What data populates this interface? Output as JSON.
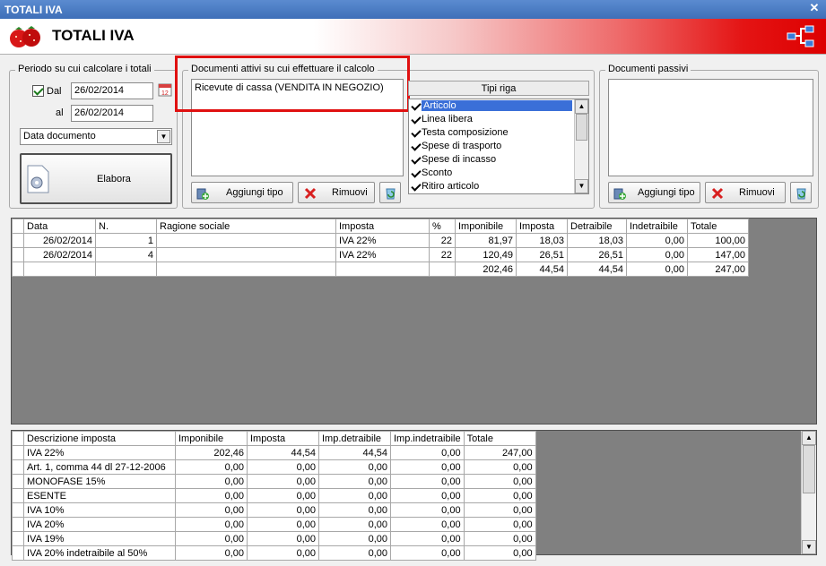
{
  "window": {
    "title": "TOTALI IVA"
  },
  "header": {
    "title": "TOTALI IVA"
  },
  "period": {
    "legend": "Periodo su cui calcolare i totali",
    "dal_label": "Dal",
    "dal_checked": true,
    "dal_value": "26/02/2014",
    "al_label": "al",
    "al_value": "26/02/2014",
    "date_type": "Data documento",
    "elabora_label": "Elabora"
  },
  "active_docs": {
    "legend": "Documenti attivi su cui effettuare il calcolo",
    "items": [
      "Ricevute di cassa (VENDITA IN NEGOZIO)"
    ],
    "add_label": "Aggiungi tipo",
    "remove_label": "Rimuovi"
  },
  "row_types": {
    "header": "Tipi riga",
    "items": [
      {
        "label": "Articolo",
        "checked": true,
        "selected": true
      },
      {
        "label": "Linea libera",
        "checked": true
      },
      {
        "label": "Testa composizione",
        "checked": true
      },
      {
        "label": "Spese di trasporto",
        "checked": true
      },
      {
        "label": "Spese di incasso",
        "checked": true
      },
      {
        "label": "Sconto",
        "checked": true
      },
      {
        "label": "Ritiro articolo",
        "checked": true
      }
    ]
  },
  "passive_docs": {
    "legend": "Documenti passivi",
    "add_label": "Aggiungi tipo",
    "remove_label": "Rimuovi"
  },
  "docs_table": {
    "columns": [
      "Data",
      "N.",
      "Ragione sociale",
      "Imposta",
      "%",
      "Imponibile",
      "Imposta",
      "Detraibile",
      "Indetraibile",
      "Totale"
    ],
    "rows": [
      [
        "26/02/2014",
        "1",
        "",
        "IVA 22%",
        "22",
        "81,97",
        "18,03",
        "18,03",
        "0,00",
        "100,00"
      ],
      [
        "26/02/2014",
        "4",
        "",
        "IVA 22%",
        "22",
        "120,49",
        "26,51",
        "26,51",
        "0,00",
        "147,00"
      ],
      [
        "",
        "",
        "",
        "",
        "",
        "202,46",
        "44,54",
        "44,54",
        "0,00",
        "247,00"
      ]
    ]
  },
  "vat_table": {
    "columns": [
      "Descrizione imposta",
      "Imponibile",
      "Imposta",
      "Imp.detraibile",
      "Imp.indetraibile",
      "Totale"
    ],
    "rows": [
      [
        "IVA 22%",
        "202,46",
        "44,54",
        "44,54",
        "0,00",
        "247,00"
      ],
      [
        "Art. 1, comma 44 dl 27-12-2006",
        "0,00",
        "0,00",
        "0,00",
        "0,00",
        "0,00"
      ],
      [
        "MONOFASE 15%",
        "0,00",
        "0,00",
        "0,00",
        "0,00",
        "0,00"
      ],
      [
        "ESENTE",
        "0,00",
        "0,00",
        "0,00",
        "0,00",
        "0,00"
      ],
      [
        "IVA 10%",
        "0,00",
        "0,00",
        "0,00",
        "0,00",
        "0,00"
      ],
      [
        "IVA 20%",
        "0,00",
        "0,00",
        "0,00",
        "0,00",
        "0,00"
      ],
      [
        "IVA 19%",
        "0,00",
        "0,00",
        "0,00",
        "0,00",
        "0,00"
      ],
      [
        "IVA 20% indetraibile al 50%",
        "0,00",
        "0,00",
        "0,00",
        "0,00",
        "0,00"
      ]
    ]
  },
  "colors": {
    "highlight_box": "#e01010",
    "selection": "#3a6fd8",
    "banner_red": "#dd0000"
  }
}
